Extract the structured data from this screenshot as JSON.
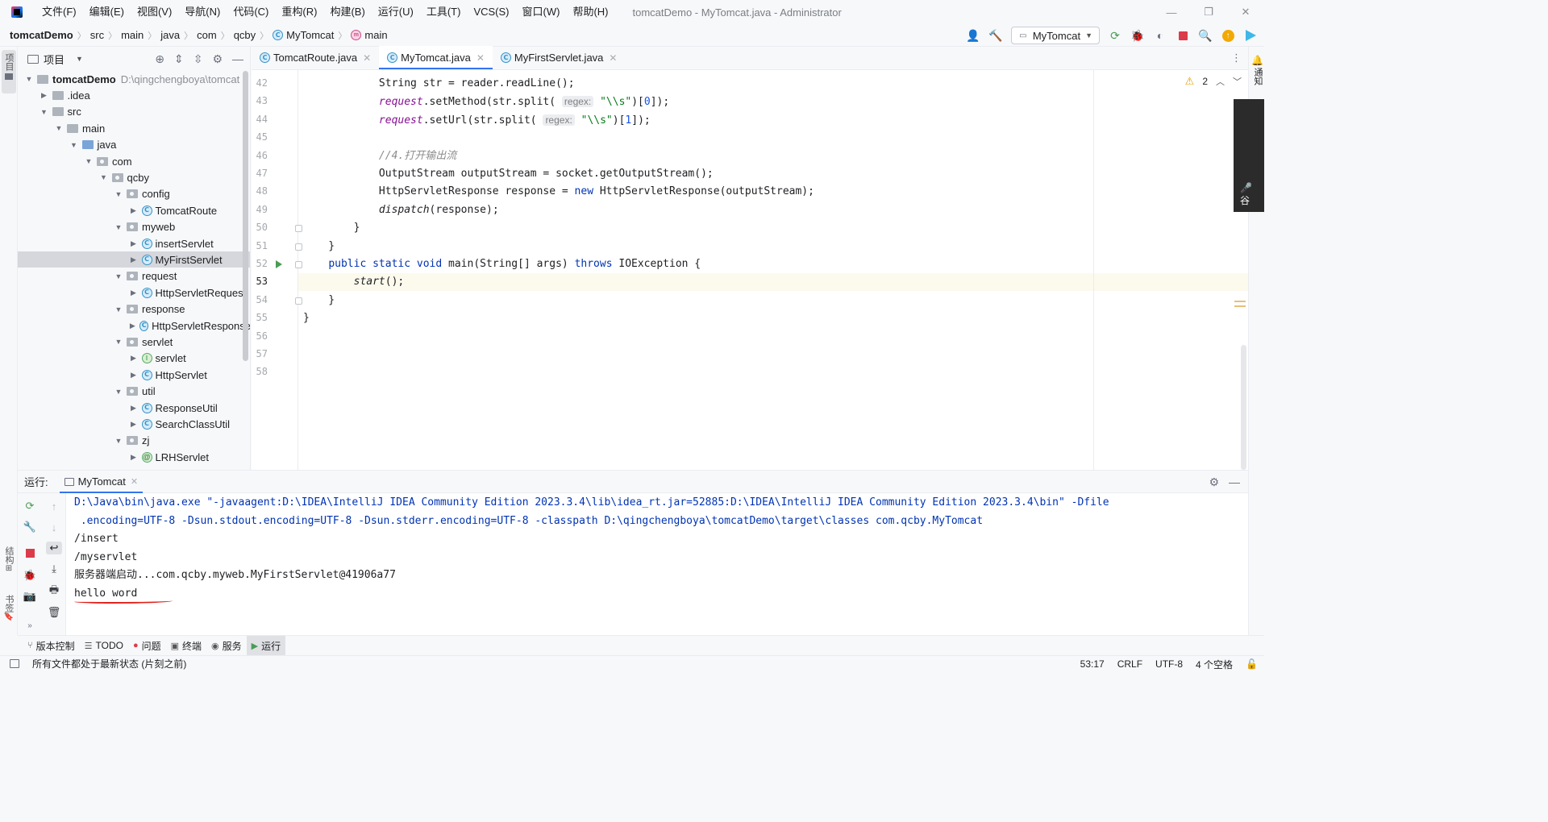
{
  "title_bar": {
    "menu": [
      "文件(F)",
      "编辑(E)",
      "视图(V)",
      "导航(N)",
      "代码(C)",
      "重构(R)",
      "构建(B)",
      "运行(U)",
      "工具(T)",
      "VCS(S)",
      "窗口(W)",
      "帮助(H)"
    ],
    "window_title": "tomcatDemo - MyTomcat.java - Administrator"
  },
  "nav": {
    "breadcrumb": [
      "tomcatDemo",
      "src",
      "main",
      "java",
      "com",
      "qcby",
      "MyTomcat",
      "main"
    ],
    "run_config": "MyTomcat"
  },
  "left_stripe": {
    "project": "项目",
    "structure": "结构",
    "bookmarks": "书签"
  },
  "project_panel": {
    "title": "项目",
    "tree": [
      {
        "label": "tomcatDemo",
        "path": "D:\\qingchengboya\\tomcat",
        "kind": "module",
        "depth": 0,
        "expanded": true
      },
      {
        "label": ".idea",
        "kind": "folder",
        "depth": 1,
        "expanded": false
      },
      {
        "label": "src",
        "kind": "folder",
        "depth": 1,
        "expanded": true
      },
      {
        "label": "main",
        "kind": "folder",
        "depth": 2,
        "expanded": true
      },
      {
        "label": "java",
        "kind": "src",
        "depth": 3,
        "expanded": true
      },
      {
        "label": "com",
        "kind": "pkg",
        "depth": 4,
        "expanded": true
      },
      {
        "label": "qcby",
        "kind": "pkg",
        "depth": 5,
        "expanded": true
      },
      {
        "label": "config",
        "kind": "pkg",
        "depth": 6,
        "expanded": true
      },
      {
        "label": "TomcatRoute",
        "kind": "class",
        "depth": 7,
        "expanded": false
      },
      {
        "label": "myweb",
        "kind": "pkg",
        "depth": 6,
        "expanded": true
      },
      {
        "label": "insertServlet",
        "kind": "class",
        "depth": 7,
        "expanded": false
      },
      {
        "label": "MyFirstServlet",
        "kind": "class",
        "depth": 7,
        "expanded": false,
        "selected": true
      },
      {
        "label": "request",
        "kind": "pkg",
        "depth": 6,
        "expanded": true
      },
      {
        "label": "HttpServletRequest",
        "kind": "class",
        "depth": 7,
        "expanded": false
      },
      {
        "label": "response",
        "kind": "pkg",
        "depth": 6,
        "expanded": true
      },
      {
        "label": "HttpServletResponse",
        "kind": "class",
        "depth": 7,
        "expanded": false
      },
      {
        "label": "servlet",
        "kind": "pkg",
        "depth": 6,
        "expanded": true
      },
      {
        "label": "servlet",
        "kind": "interface",
        "depth": 7,
        "expanded": false
      },
      {
        "label": "HttpServlet",
        "kind": "class",
        "depth": 7,
        "expanded": false
      },
      {
        "label": "util",
        "kind": "pkg",
        "depth": 6,
        "expanded": true
      },
      {
        "label": "ResponseUtil",
        "kind": "class",
        "depth": 7,
        "expanded": false
      },
      {
        "label": "SearchClassUtil",
        "kind": "class",
        "depth": 7,
        "expanded": false
      },
      {
        "label": "zj",
        "kind": "pkg",
        "depth": 6,
        "expanded": true
      },
      {
        "label": "LRHServlet",
        "kind": "annotation",
        "depth": 7,
        "expanded": false
      }
    ]
  },
  "editor": {
    "tabs": [
      {
        "label": "TomcatRoute.java",
        "active": false
      },
      {
        "label": "MyTomcat.java",
        "active": true
      },
      {
        "label": "MyFirstServlet.java",
        "active": false
      }
    ],
    "warnings": "2",
    "current_line": 53,
    "lines": [
      {
        "no": 42,
        "html": "            <span>String str = reader.readLine();</span>"
      },
      {
        "no": 43,
        "html": "            <span class=\"it\">request</span>.setMethod(str.split( <span class=\"hint\">regex:</span> <span class=\"str\">\"\\\\s\"</span>)[<span class=\"num\">0</span>]);"
      },
      {
        "no": 44,
        "html": "            <span class=\"it\">request</span>.setUrl(str.split( <span class=\"hint\">regex:</span> <span class=\"str\">\"\\\\s\"</span>)[<span class=\"num\">1</span>]);"
      },
      {
        "no": 45,
        "html": ""
      },
      {
        "no": 46,
        "html": "            <span class=\"cm\">//4.打开输出流</span>"
      },
      {
        "no": 47,
        "html": "            OutputStream outputStream = socket.getOutputStream();"
      },
      {
        "no": 48,
        "html": "            HttpServletResponse response = <span class=\"kw\">new</span> HttpServletResponse(outputStream);"
      },
      {
        "no": 49,
        "html": "            <span class=\"itf\">dispatch</span>(response);"
      },
      {
        "no": 50,
        "html": "        }"
      },
      {
        "no": 51,
        "html": "    }"
      },
      {
        "no": 52,
        "html": "    <span class=\"kw\">public static void</span> main(String[] args) <span class=\"kw\">throws</span> IOException {"
      },
      {
        "no": 53,
        "html": "        <span class=\"itf\">start</span>();"
      },
      {
        "no": 54,
        "html": "    }"
      },
      {
        "no": 55,
        "html": "}"
      },
      {
        "no": 56,
        "html": ""
      },
      {
        "no": 57,
        "html": ""
      },
      {
        "no": 58,
        "html": ""
      }
    ]
  },
  "run_panel": {
    "label": "运行:",
    "tab": "MyTomcat",
    "console": [
      {
        "text": "D:\\Java\\bin\\java.exe \"-javaagent:D:\\IDEA\\IntelliJ IDEA Community Edition 2023.3.4\\lib\\idea_rt.jar=52885:D:\\IDEA\\IntelliJ IDEA Community Edition 2023.3.4\\bin\" -Dfile",
        "cmd": true
      },
      {
        "text": " .encoding=UTF-8 -Dsun.stdout.encoding=UTF-8 -Dsun.stderr.encoding=UTF-8 -classpath D:\\qingchengboya\\tomcatDemo\\target\\classes com.qcby.MyTomcat",
        "cmd": true
      },
      {
        "text": "/insert",
        "cmd": false
      },
      {
        "text": "/myservlet",
        "cmd": false
      },
      {
        "text": "服务器端启动...com.qcby.myweb.MyFirstServlet@41906a77",
        "cmd": false
      },
      {
        "text": "hello word",
        "cmd": false
      }
    ]
  },
  "bottom_tabs": [
    {
      "label": "版本控制",
      "icon": "branch-icon",
      "active": false
    },
    {
      "label": "TODO",
      "icon": "list-icon",
      "active": false
    },
    {
      "label": "问题",
      "icon": "error-icon",
      "active": false
    },
    {
      "label": "终端",
      "icon": "terminal-icon",
      "active": false
    },
    {
      "label": "服务",
      "icon": "services-icon",
      "active": false
    },
    {
      "label": "运行",
      "icon": "run-icon",
      "active": true
    }
  ],
  "status_bar": {
    "message": "所有文件都处于最新状态 (片刻之前)",
    "position": "53:17",
    "line_sep": "CRLF",
    "encoding": "UTF-8",
    "indent": "4 个空格"
  },
  "right_stripe": {
    "notifications": "通知"
  },
  "floating_widget_text": "谷"
}
